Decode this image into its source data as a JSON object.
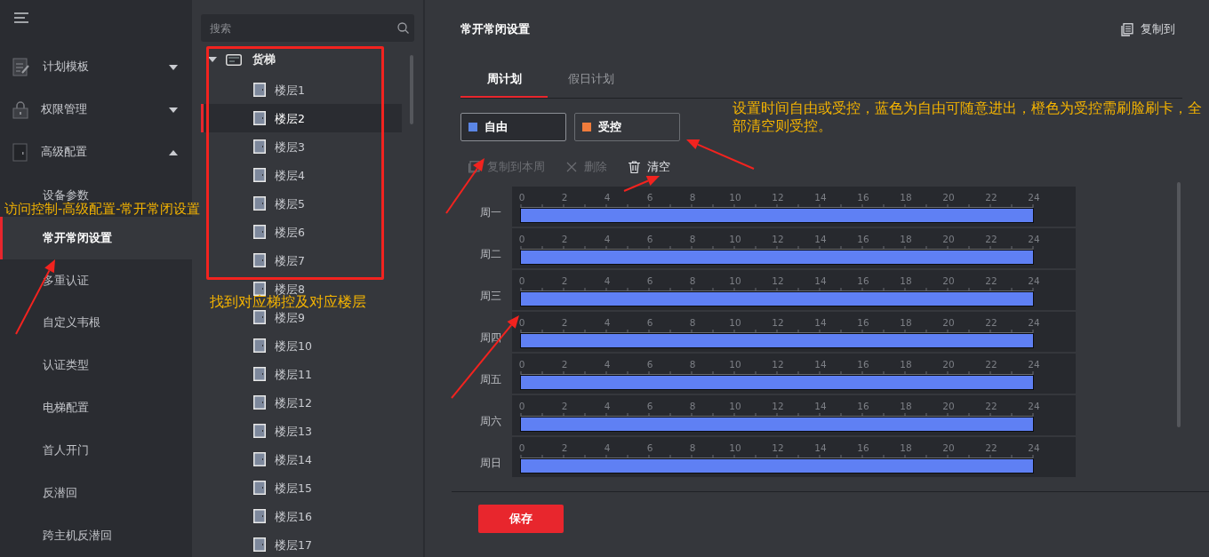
{
  "sidebar": {
    "groups": [
      {
        "label": "计划模板",
        "expanded": false
      },
      {
        "label": "权限管理",
        "expanded": false
      },
      {
        "label": "高级配置",
        "expanded": true,
        "children": [
          {
            "label": "设备参数",
            "selected": false
          },
          {
            "label": "常开常闭设置",
            "selected": true
          },
          {
            "label": "多重认证",
            "selected": false
          },
          {
            "label": "自定义韦根",
            "selected": false
          },
          {
            "label": "认证类型",
            "selected": false
          },
          {
            "label": "电梯配置",
            "selected": false
          },
          {
            "label": "首人开门",
            "selected": false
          },
          {
            "label": "反潜回",
            "selected": false
          },
          {
            "label": "跨主机反潜回",
            "selected": false
          }
        ]
      }
    ]
  },
  "tree": {
    "search": {
      "placeholder": "搜索"
    },
    "root": {
      "label": "货梯",
      "expanded": true,
      "children": [
        {
          "label": "楼层1",
          "selected": false
        },
        {
          "label": "楼层2",
          "selected": true
        },
        {
          "label": "楼层3",
          "selected": false
        },
        {
          "label": "楼层4",
          "selected": false
        },
        {
          "label": "楼层5",
          "selected": false
        },
        {
          "label": "楼层6",
          "selected": false
        },
        {
          "label": "楼层7",
          "selected": false
        },
        {
          "label": "楼层8",
          "selected": false
        },
        {
          "label": "楼层9",
          "selected": false
        },
        {
          "label": "楼层10",
          "selected": false
        },
        {
          "label": "楼层11",
          "selected": false
        },
        {
          "label": "楼层12",
          "selected": false
        },
        {
          "label": "楼层13",
          "selected": false
        },
        {
          "label": "楼层14",
          "selected": false
        },
        {
          "label": "楼层15",
          "selected": false
        },
        {
          "label": "楼层16",
          "selected": false
        },
        {
          "label": "楼层17",
          "selected": false
        }
      ]
    }
  },
  "main": {
    "title": "常开常闭设置",
    "copy_to": "复制到",
    "tabs": [
      {
        "label": "周计划",
        "selected": true
      },
      {
        "label": "假日计划",
        "selected": false
      }
    ],
    "modes": [
      {
        "label": "自由",
        "color": "#5b86e5",
        "selected": true
      },
      {
        "label": "受控",
        "color": "#f07c3c",
        "selected": false
      }
    ],
    "actions": [
      {
        "label": "复制到本周",
        "disabled": true
      },
      {
        "label": "删除",
        "disabled": true
      },
      {
        "label": "清空",
        "disabled": false
      }
    ],
    "days": [
      {
        "label": "周一",
        "ticks": [
          "0",
          "2",
          "4",
          "6",
          "8",
          "10",
          "12",
          "14",
          "16",
          "18",
          "20",
          "22",
          "24"
        ]
      },
      {
        "label": "周二",
        "ticks": [
          "0",
          "2",
          "4",
          "6",
          "8",
          "10",
          "12",
          "14",
          "16",
          "18",
          "20",
          "22",
          "24"
        ]
      },
      {
        "label": "周三",
        "ticks": [
          "0",
          "2",
          "4",
          "6",
          "8",
          "10",
          "12",
          "14",
          "16",
          "18",
          "20",
          "22",
          "24"
        ]
      },
      {
        "label": "周四",
        "ticks": [
          "0",
          "2",
          "4",
          "6",
          "8",
          "10",
          "12",
          "14",
          "16",
          "18",
          "20",
          "22",
          "24"
        ]
      },
      {
        "label": "周五",
        "ticks": [
          "0",
          "2",
          "4",
          "6",
          "8",
          "10",
          "12",
          "14",
          "16",
          "18",
          "20",
          "22",
          "24"
        ]
      },
      {
        "label": "周六",
        "ticks": [
          "0",
          "2",
          "4",
          "6",
          "8",
          "10",
          "12",
          "14",
          "16",
          "18",
          "20",
          "22",
          "24"
        ]
      },
      {
        "label": "周日",
        "ticks": [
          "0",
          "2",
          "4",
          "6",
          "8",
          "10",
          "12",
          "14",
          "16",
          "18",
          "20",
          "22",
          "24"
        ]
      }
    ],
    "save": "保存"
  },
  "annotations": [
    {
      "text": "访问控制-高级配置-常开常闭设置"
    },
    {
      "text": "找到对应梯控及对应楼层"
    },
    {
      "text": "设置时间自由或受控，蓝色为自由可随意进出，橙色为受控需刷脸刷卡，全部清空则受控。"
    }
  ]
}
